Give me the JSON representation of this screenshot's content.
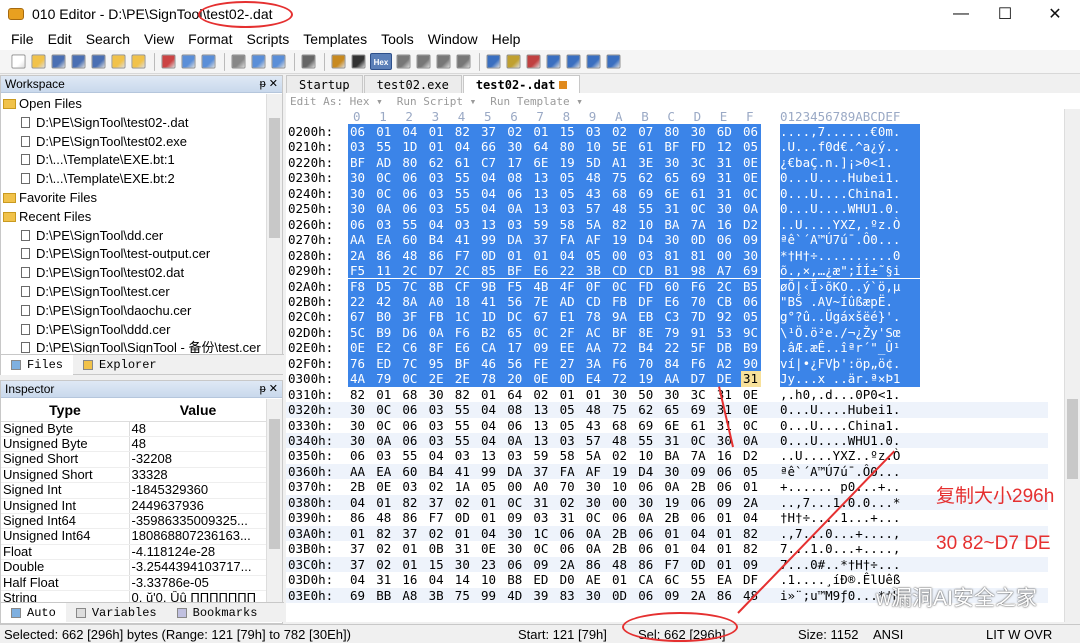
{
  "window": {
    "app_name": "010 Editor",
    "title_sep": " - ",
    "path": "D:\\PE\\SignTool\\",
    "file": "test02-.dat",
    "ctl_minimize": "—",
    "ctl_maximize": "☐",
    "ctl_close": "✕"
  },
  "menu": [
    "File",
    "Edit",
    "Search",
    "View",
    "Format",
    "Scripts",
    "Templates",
    "Tools",
    "Window",
    "Help"
  ],
  "toolbar": {
    "hex_label": "Hex"
  },
  "workspace": {
    "title": "Workspace",
    "pin": "ᵽ ✕",
    "sections": [
      {
        "label": "Open Files",
        "items": [
          "D:\\PE\\SignTool\\test02-.dat",
          "D:\\PE\\SignTool\\test02.exe",
          "D:\\...\\Template\\EXE.bt:1",
          "D:\\...\\Template\\EXE.bt:2"
        ]
      },
      {
        "label": "Favorite Files",
        "items": []
      },
      {
        "label": "Recent Files",
        "items": [
          "D:\\PE\\SignTool\\dd.cer",
          "D:\\PE\\SignTool\\test-output.cer",
          "D:\\PE\\SignTool\\test02.dat",
          "D:\\PE\\SignTool\\test.cer",
          "D:\\PE\\SignTool\\daochu.cer",
          "D:\\PE\\SignTool\\ddd.cer",
          "D:\\PE\\SignTool\\SignTool - 备份\\test.cer"
        ]
      }
    ],
    "tabs": [
      "Files",
      "Explorer"
    ]
  },
  "inspector": {
    "title": "Inspector",
    "pin": "ᵽ ✕",
    "col_type": "Type",
    "col_value": "Value",
    "rows": [
      [
        "Signed Byte",
        "48"
      ],
      [
        "Unsigned Byte",
        "48"
      ],
      [
        "Signed Short",
        "-32208"
      ],
      [
        "Unsigned Short",
        "33328"
      ],
      [
        "Signed Int",
        "-1845329360"
      ],
      [
        "Unsigned Int",
        "2449637936"
      ],
      [
        "Signed Int64",
        "-35986335009325..."
      ],
      [
        "Unsigned Int64",
        "180868807236163..."
      ],
      [
        "Float",
        "-4.118124e-28"
      ],
      [
        "Double",
        "-3.2544394103717..."
      ],
      [
        "Half Float",
        "-3.33786e-05"
      ],
      [
        "String",
        "0, ŭ'0, Ûû ΠΠΠΠΠΠΠ"
      ]
    ],
    "tabs": [
      "Auto",
      "Variables",
      "Bookmarks"
    ]
  },
  "editor": {
    "tabs": [
      {
        "label": "Startup",
        "active": false
      },
      {
        "label": "test02.exe",
        "active": false
      },
      {
        "label": "test02-.dat",
        "active": true
      }
    ],
    "bar": [
      "Edit As: Hex ▾",
      "Run Script ▾",
      "Run Template ▾"
    ],
    "col_headers": [
      "0",
      "1",
      "2",
      "3",
      "4",
      "5",
      "6",
      "7",
      "8",
      "9",
      "A",
      "B",
      "C",
      "D",
      "E",
      "F"
    ],
    "ascii_header": "0123456789ABCDEF",
    "rows": [
      {
        "addr": "0200h:",
        "hex": "06 01 04 01 82 37 02 01 15 03 02 07 80 30 6D 06",
        "asc": "....,7......€0m."
      },
      {
        "addr": "0210h:",
        "hex": "03 55 1D 01 04 66 30 64 80 10 5E 61 BF FD 12 05",
        "asc": ".U...f0d€.^a¿ý.."
      },
      {
        "addr": "0220h:",
        "hex": "BF AD 80 62 61 C7 17 6E 19 5D A1 3E 30 3C 31 0E",
        "asc": "¿­€baÇ.n.]¡>0<1."
      },
      {
        "addr": "0230h:",
        "hex": "30 0C 06 03 55 04 08 13 05 48 75 62 65 69 31 0E",
        "asc": "0...U....Hubei1."
      },
      {
        "addr": "0240h:",
        "hex": "30 0C 06 03 55 04 06 13 05 43 68 69 6E 61 31 0C",
        "asc": "0...U....China1."
      },
      {
        "addr": "0250h:",
        "hex": "30 0A 06 03 55 04 0A 13 03 57 48 55 31 0C 30 0A",
        "asc": "0...U....WHU1.0."
      },
      {
        "addr": "0260h:",
        "hex": "06 03 55 04 03 13 03 59 58 5A 82 10 BA 7A 16 D2",
        "asc": "..U....YXZ‚.ºz.Ò"
      },
      {
        "addr": "0270h:",
        "hex": "AA EA 60 B4 41 99 DA 37 FA AF 19 D4 30 0D 06 09",
        "asc": "ªê`´A™Ú7ú¯.Ô0..."
      },
      {
        "addr": "0280h:",
        "hex": "2A 86 48 86 F7 0D 01 01 04 05 00 03 81 81 00 30",
        "asc": "*†H†÷..........0"
      },
      {
        "addr": "0290h:",
        "hex": "F5 11 2C D7 2C 85 BF E6 22 3B CD CD B1 98 A7 69",
        "asc": "õ.,×,…¿æ\";ÍÍ±˜§i"
      },
      {
        "addr": "02A0h:",
        "hex": "F8 D5 7C 8B CF 9B F5 4B 4F 0F 0C FD 60 F6 2C B5",
        "asc": "øÕ|‹Ï›õKO..ý`ö,µ"
      },
      {
        "addr": "02B0h:",
        "hex": "22 42 8A A0 18 41 56 7E AD CD FB DF E6 70 CB 06",
        "asc": "\"BŠ .AV~­ÍûßæpË."
      },
      {
        "addr": "02C0h:",
        "hex": "67 B0 3F FB 1C 1D DC 67 E1 78 9A EB C3 7D 92 05",
        "asc": "g°?û..Ügáxšëé}'."
      },
      {
        "addr": "02D0h:",
        "hex": "5C B9 D6 0A F6 B2 65 0C 2F AC BF 8E 79 91 53 9C",
        "asc": "\\¹Ö.ö²e./¬¿Žy'Sœ"
      },
      {
        "addr": "02E0h:",
        "hex": "0E E2 C6 8F E6 CA 17 09 EE AA 72 B4 22 5F DB B9",
        "asc": ".âÆ.æÊ..îªr´\"_Û¹"
      },
      {
        "addr": "02F0h:",
        "hex": "76 ED 7C 95 BF 46 56 FE 27 3A F6 70 84 F6 A2 90",
        "asc": "ví|•¿FVþ':öp„ö¢."
      },
      {
        "addr": "0300h:",
        "hex": "4A 79 0C 2E 2E 78 20 0E 0D E4 72 19 AA D7 DE 31",
        "asc": "Jy...x ..är.ª×Þ1"
      },
      {
        "addr": "0310h:",
        "hex": "82 01 68 30 82 01 64 02 01 01 30 50 30 3C 31 0E",
        "asc": ",.h0,.d...0P0<1."
      },
      {
        "addr": "0320h:",
        "hex": "30 0C 06 03 55 04 08 13 05 48 75 62 65 69 31 0E",
        "asc": "0...U....Hubei1."
      },
      {
        "addr": "0330h:",
        "hex": "30 0C 06 03 55 04 06 13 05 43 68 69 6E 61 31 0C",
        "asc": "0...U....China1."
      },
      {
        "addr": "0340h:",
        "hex": "30 0A 06 03 55 04 0A 13 03 57 48 55 31 0C 30 0A",
        "asc": "0...U....WHU1.0."
      },
      {
        "addr": "0350h:",
        "hex": "06 03 55 04 03 13 03 59 58 5A 02 10 BA 7A 16 D2",
        "asc": "..U....YXZ..ºz.Ò"
      },
      {
        "addr": "0360h:",
        "hex": "AA EA 60 B4 41 99 DA 37 FA AF 19 D4 30 09 06 05",
        "asc": "ªê`´A™Ú7ú¯.Ô0..."
      },
      {
        "addr": "0370h:",
        "hex": "2B 0E 03 02 1A 05 00 A0 70 30 10 06 0A 2B 06 01",
        "asc": "+...... p0...+.."
      },
      {
        "addr": "0380h:",
        "hex": "04 01 82 37 02 01 0C 31 02 30 00 30 19 06 09 2A",
        "asc": "..,7...1.0.0...*"
      },
      {
        "addr": "0390h:",
        "hex": "86 48 86 F7 0D 01 09 03 31 0C 06 0A 2B 06 01 04",
        "asc": "†H†÷....1...+..."
      },
      {
        "addr": "03A0h:",
        "hex": "01 82 37 02 01 04 30 1C 06 0A 2B 06 01 04 01 82",
        "asc": ".,7...0...+....,"
      },
      {
        "addr": "03B0h:",
        "hex": "37 02 01 0B 31 0E 30 0C 06 0A 2B 06 01 04 01 82",
        "asc": "7...1.0...+....,"
      },
      {
        "addr": "03C0h:",
        "hex": "37 02 01 15 30 23 06 09 2A 86 48 86 F7 0D 01 09",
        "asc": "7...0#..*†H†÷..."
      },
      {
        "addr": "03D0h:",
        "hex": "04 31 16 04 14 10 B8 ED D0 AE 01 CA 6C 55 EA DF",
        "asc": ".1....¸íÐ®.ÊlUêß"
      },
      {
        "addr": "03E0h:",
        "hex": "69 BB A8 3B 75 99 4D 39 83 30 0D 06 09 2A 86 48",
        "asc": "i»¨;u™M9ƒ0...*†H"
      }
    ],
    "selection": {
      "from_row": 0,
      "to_row": 16,
      "to_col": 14
    },
    "cursor": {
      "row": 16,
      "col": 15
    }
  },
  "status": {
    "selected": "Selected: 662 [296h] bytes (Range: 121 [79h] to 782 [30Eh])",
    "start": "Start: 121 [79h]",
    "sel": "Sel: 662 [296h]",
    "size": "Size: 1152",
    "encoding": "ANSI",
    "modes": "LIT  W  OVR"
  },
  "annotations": {
    "line1": "复制大小296h",
    "line2": "30 82~D7 DE",
    "color": "#e53030"
  },
  "watermark": "w漏洞AI安全之家",
  "colors": {
    "selection": "#3b84e8",
    "cursor": "#f8e19a",
    "panel_header": "#c9d9ec"
  }
}
